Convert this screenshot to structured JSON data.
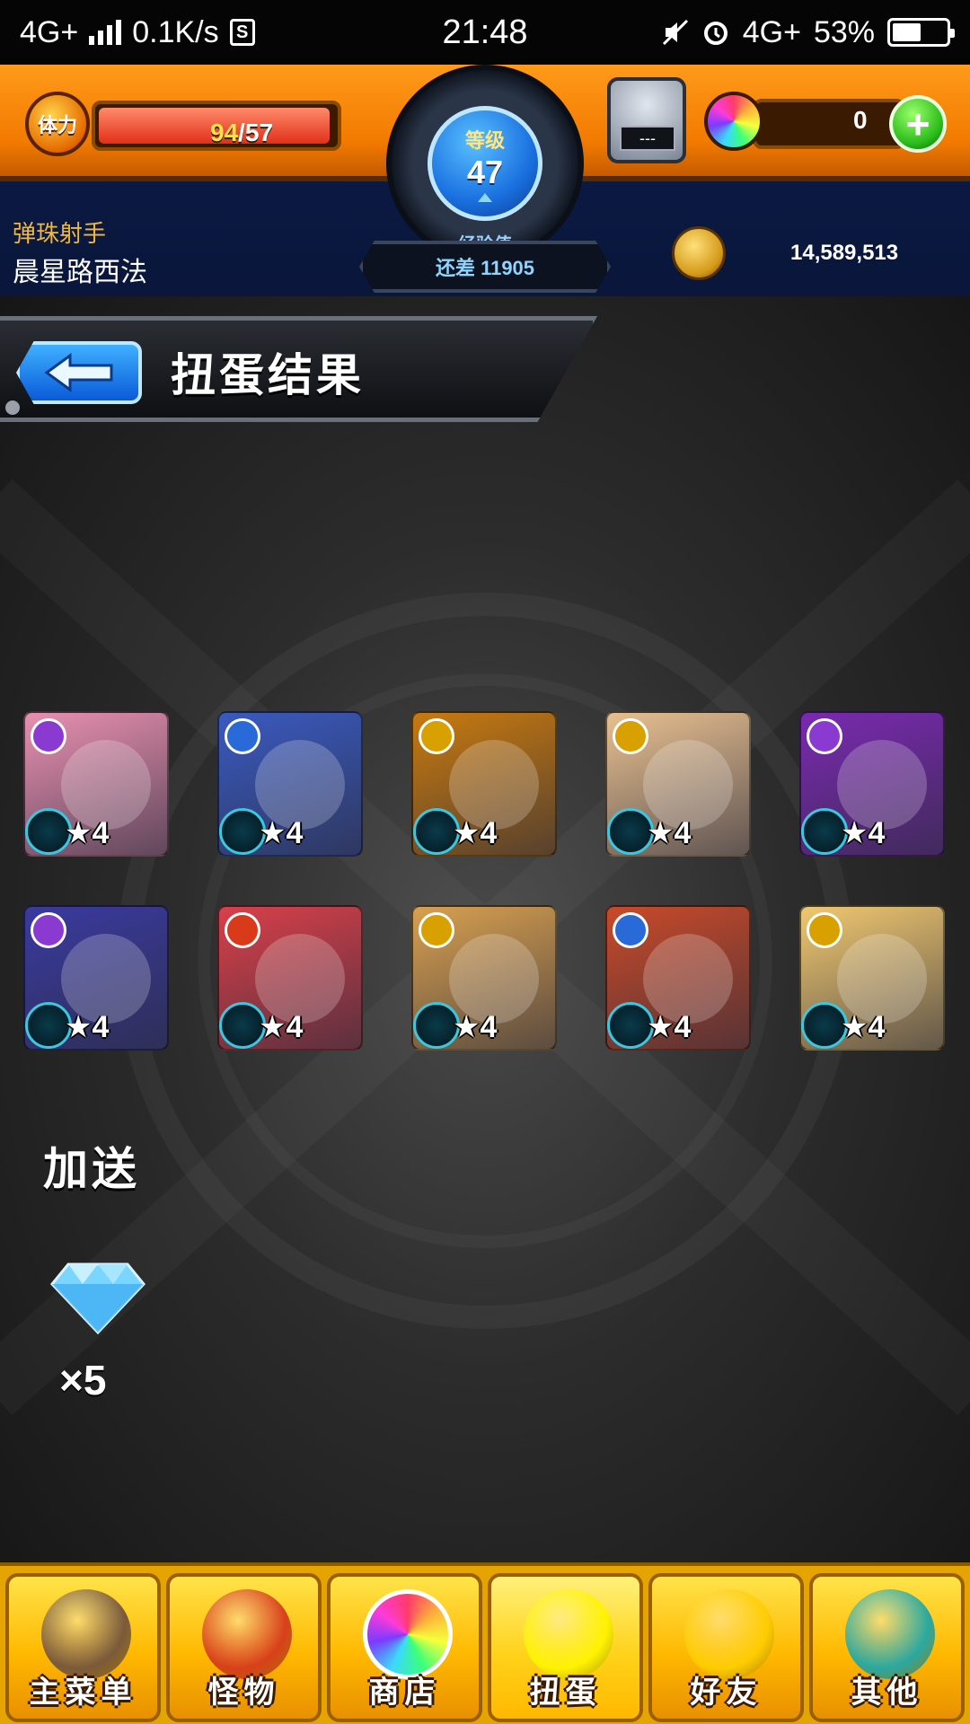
{
  "status_bar": {
    "network": "4G+",
    "speed": "0.1K/s",
    "s_icon": "S",
    "time": "21:48",
    "network_right": "4G+",
    "battery": "53%",
    "battery_level": 0.53
  },
  "header": {
    "stamina_label": "体力",
    "stamina_current": "94",
    "stamina_max": "/57",
    "stamina_level": 0.98,
    "level_label": "等级",
    "level": "47",
    "exp_label": "经验值",
    "exp_remaining": "还差 11905",
    "monster_box_value": "---",
    "orb_count": "0",
    "add_orb": "+",
    "player_class": "弹珠射手",
    "player_name": "晨星路西法",
    "coins": "14,589,513"
  },
  "page": {
    "title": "扭蛋结果"
  },
  "results": [
    {
      "attribute_color": "#8a3ad0",
      "card_color": "#e890b0",
      "attr_icon": "dark-attr-icon",
      "stars": "★4"
    },
    {
      "attribute_color": "#2a6ad8",
      "card_color": "#3a5ac0",
      "attr_icon": "water-attr-icon",
      "stars": "★4"
    },
    {
      "attribute_color": "#d8a000",
      "card_color": "#c87a10",
      "attr_icon": "light-attr-icon",
      "stars": "★4"
    },
    {
      "attribute_color": "#d8a000",
      "card_color": "#e8c090",
      "attr_icon": "light-attr-icon",
      "stars": "★4"
    },
    {
      "attribute_color": "#8a3ad0",
      "card_color": "#7a2ab0",
      "attr_icon": "dark-attr-icon",
      "stars": "★4"
    },
    {
      "attribute_color": "#8a3ad0",
      "card_color": "#3a3aa0",
      "attr_icon": "dark-attr-icon",
      "stars": "★4"
    },
    {
      "attribute_color": "#d83a1a",
      "card_color": "#d8404a",
      "attr_icon": "fire-attr-icon",
      "stars": "★4"
    },
    {
      "attribute_color": "#d8a000",
      "card_color": "#d8a050",
      "attr_icon": "light-attr-icon",
      "stars": "★4"
    },
    {
      "attribute_color": "#2a6ad8",
      "card_color": "#c84a2a",
      "attr_icon": "water-attr-icon",
      "stars": "★4"
    },
    {
      "attribute_color": "#d8a000",
      "card_color": "#f0c870",
      "attr_icon": "light-attr-icon",
      "stars": "★4"
    }
  ],
  "bonus": {
    "label": "加送",
    "gem_icon": "diamond-icon",
    "count": "×5"
  },
  "nav": [
    {
      "label": "主菜单",
      "icon": "main-menu-gate-icon",
      "color": "#7a5a3a",
      "active": false
    },
    {
      "label": "怪物",
      "icon": "monster-icon",
      "color": "#d8401a",
      "active": false
    },
    {
      "label": "商店",
      "icon": "rainbow-orb-icon",
      "color": "#ffffff",
      "active": false
    },
    {
      "label": "扭蛋",
      "icon": "gacha-egg-icon",
      "color": "#fff200",
      "active": true
    },
    {
      "label": "好友",
      "icon": "friends-icon",
      "color": "#ffcc00",
      "active": false
    },
    {
      "label": "其他",
      "icon": "question-icon",
      "color": "#2aa8a0",
      "active": false
    }
  ]
}
